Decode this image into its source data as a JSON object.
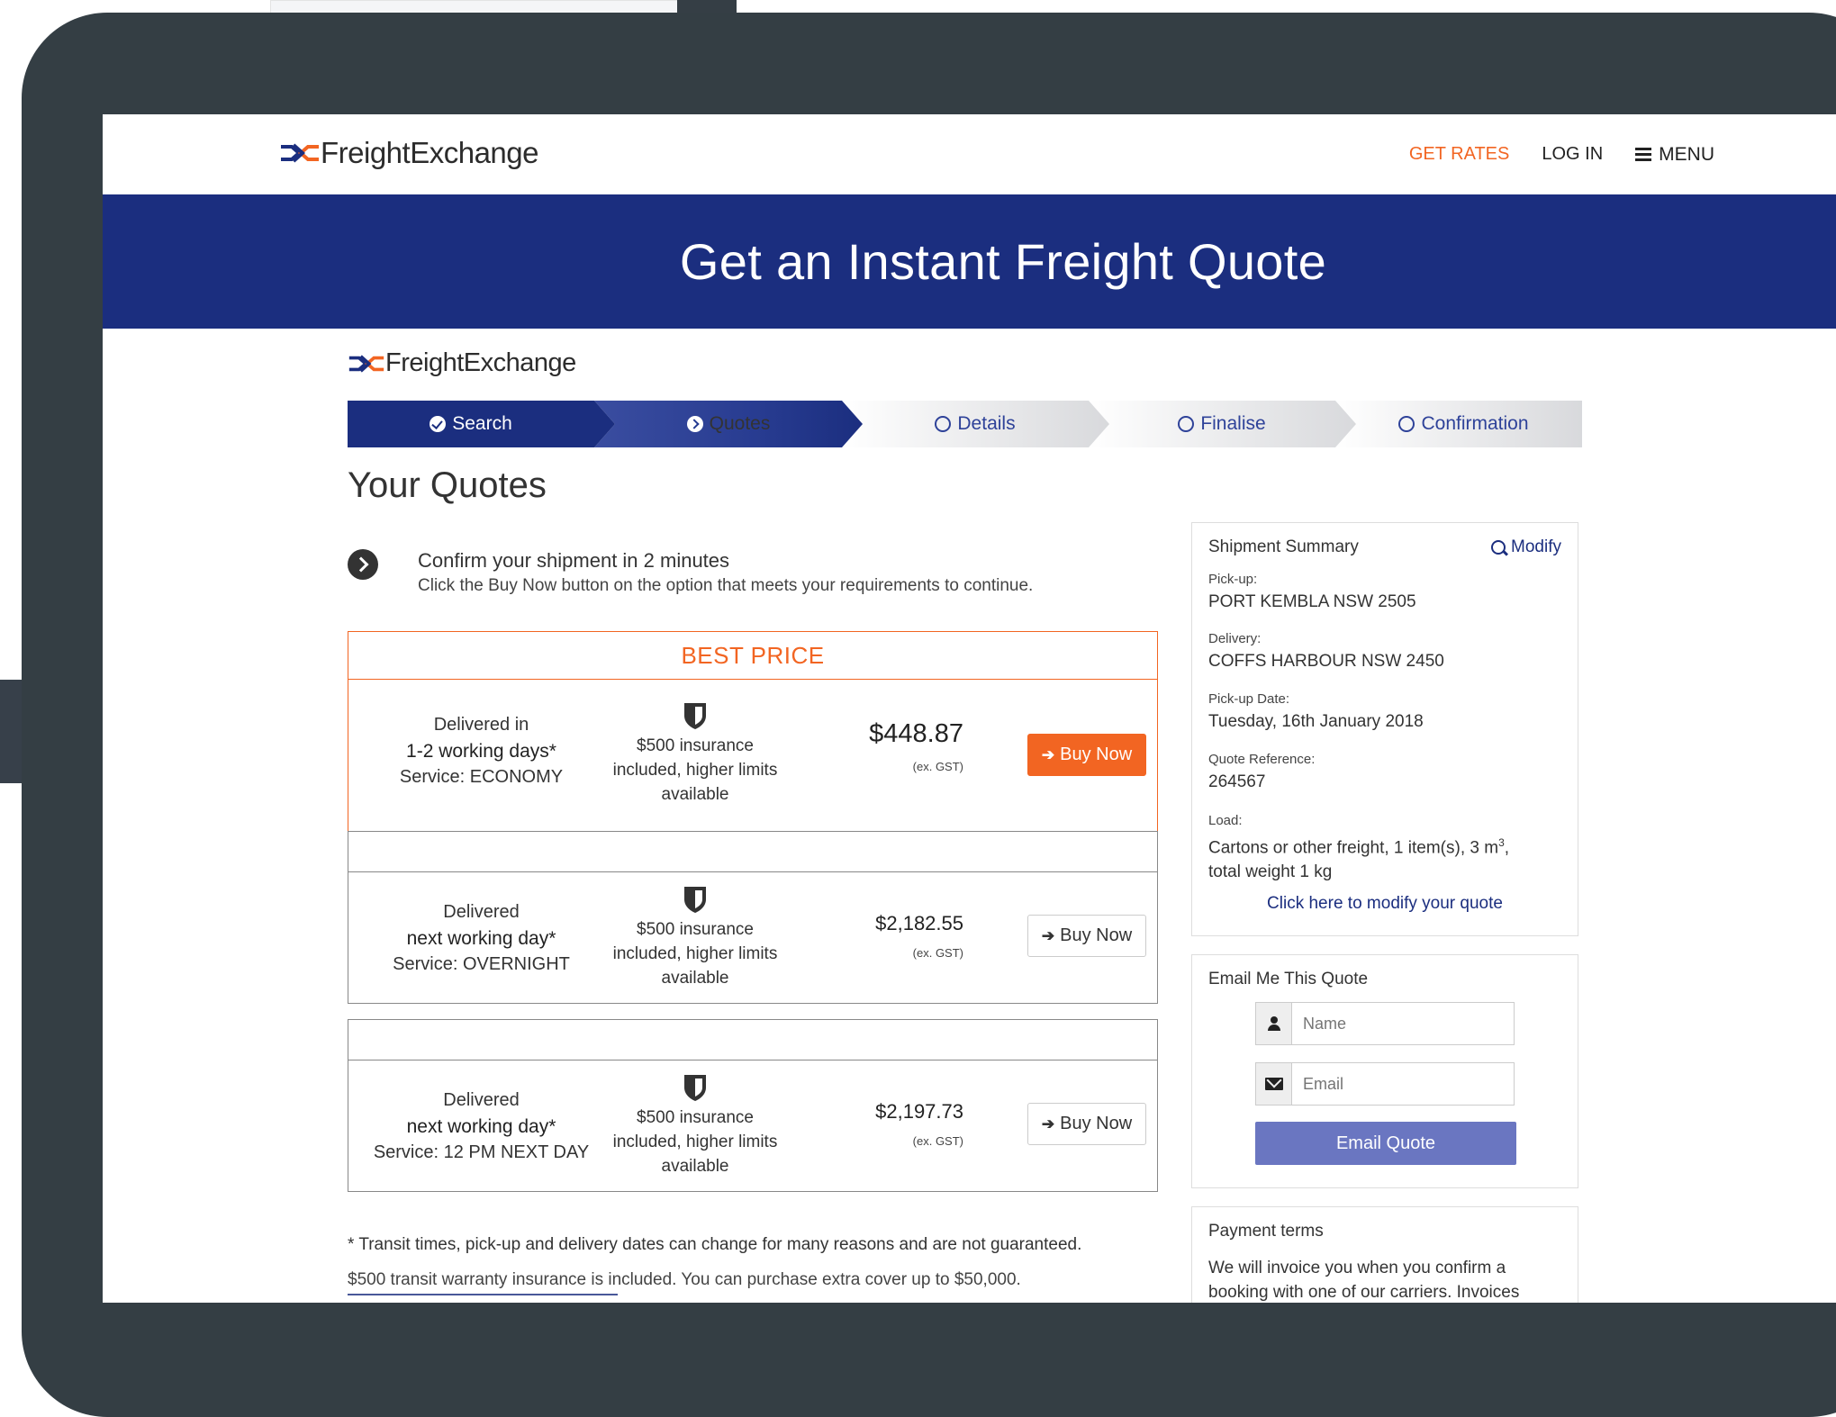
{
  "nav": {
    "logo_text": "FreightExchange",
    "get_rates": "GET RATES",
    "log_in": "LOG IN",
    "menu": "MENU"
  },
  "hero": {
    "title": "Get an Instant Freight Quote"
  },
  "widget": {
    "logo_text": "FreightExchange",
    "steps": [
      {
        "label": "Search",
        "state": "done"
      },
      {
        "label": "Quotes",
        "state": "current"
      },
      {
        "label": "Details",
        "state": "todo"
      },
      {
        "label": "Finalise",
        "state": "todo"
      },
      {
        "label": "Confirmation",
        "state": "todo"
      }
    ],
    "heading": "Your Quotes",
    "confirm_title": "Confirm your shipment in 2 minutes",
    "confirm_sub": "Click the Buy Now button on the option that meets your requirements to continue.",
    "best_price_label": "BEST PRICE",
    "service_prefix": "Service:",
    "quotes": [
      {
        "delivered": "Delivered in",
        "timeframe": "1-2 working days*",
        "service": "ECONOMY",
        "insurance_1": "$500 insurance",
        "insurance_2": "included, higher limits",
        "insurance_3": "available",
        "price": "$448.87",
        "gst": "(ex. GST)",
        "buy": "Buy Now"
      },
      {
        "delivered": "Delivered",
        "timeframe": "next working day*",
        "service": "OVERNIGHT",
        "insurance_1": "$500 insurance",
        "insurance_2": "included, higher limits",
        "insurance_3": "available",
        "price": "$2,182.55",
        "gst": "(ex. GST)",
        "buy": "Buy Now"
      },
      {
        "delivered": "Delivered",
        "timeframe": "next working day*",
        "service": "12 PM NEXT DAY",
        "insurance_1": "$500 insurance",
        "insurance_2": "included, higher limits",
        "insurance_3": "available",
        "price": "$2,197.73",
        "gst": "(ex. GST)",
        "buy": "Buy Now"
      }
    ],
    "footnote_1": "* Transit times, pick-up and delivery dates can change for many reasons and are not guaranteed.",
    "footnote_2": "$500 transit warranty insurance is included. You can purchase extra cover up to $50,000."
  },
  "summary": {
    "title": "Shipment Summary",
    "modify": "Modify",
    "pickup_label": "Pick-up:",
    "pickup": "PORT KEMBLA NSW 2505",
    "delivery_label": "Delivery:",
    "delivery": "COFFS HARBOUR NSW 2450",
    "pickup_date_label": "Pick-up Date:",
    "pickup_date": "Tuesday, 16th January 2018",
    "quote_ref_label": "Quote Reference:",
    "quote_ref": "264567",
    "load_label": "Load:",
    "load_line1": "Cartons or other freight,  1 item(s), 3 m",
    "load_sup": "3",
    "load_comma": ",",
    "load_line2": "total weight 1 kg",
    "modify_link": "Click here to modify your quote"
  },
  "email": {
    "title": "Email Me This Quote",
    "name_placeholder": "Name",
    "email_placeholder": "Email",
    "button": "Email Quote"
  },
  "payment": {
    "title": "Payment terms",
    "text": "We will invoice you when you confirm a booking with one of our carriers. Invoices"
  },
  "colors": {
    "brand_navy": "#1b2e7f",
    "accent_orange": "#f26522",
    "device_frame": "#343e44",
    "email_button": "#6a76c1"
  }
}
